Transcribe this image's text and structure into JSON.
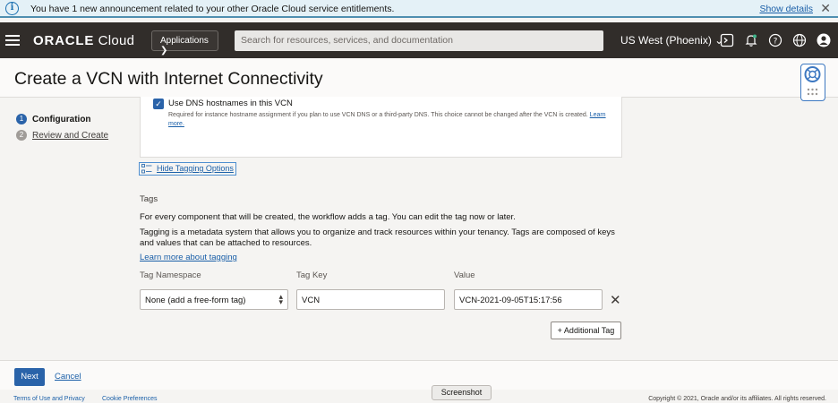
{
  "announcement": {
    "message": "You have 1 new announcement related to your other Oracle Cloud service entitlements.",
    "show_details": "Show details"
  },
  "nav": {
    "brand_bold": "ORACLE",
    "brand_rest": " Cloud",
    "applications": "Applications",
    "search_placeholder": "Search for resources, services, and documentation",
    "region": "US West (Phoenix)"
  },
  "page": {
    "title": "Create a VCN with Internet Connectivity"
  },
  "steps": [
    {
      "num": "1",
      "label": "Configuration"
    },
    {
      "num": "2",
      "label": "Review and Create"
    }
  ],
  "dns": {
    "label": "Use DNS hostnames in this VCN",
    "help": "Required for instance hostname assignment if you plan to use VCN DNS or a third-party DNS. This choice cannot be changed after the VCN is created. ",
    "learn_more": "Learn more."
  },
  "tagging": {
    "toggle": "Hide Tagging Options",
    "section_title": "Tags",
    "desc1": "For every component that will be created, the workflow adds a tag. You can edit the tag now or later.",
    "desc2": "Tagging is a metadata system that allows you to organize and track resources within your tenancy. Tags are composed of keys and values that can be attached to resources.",
    "learn_more": "Learn more about tagging",
    "col_namespace": "Tag Namespace",
    "col_key": "Tag Key",
    "col_value": "Value",
    "namespace_value": "None (add a free-form tag)",
    "key_value": "VCN",
    "value_value": "VCN-2021-09-05T15:17:56",
    "add_tag": "+ Additional Tag"
  },
  "actions": {
    "next": "Next",
    "cancel": "Cancel"
  },
  "footer": {
    "terms": "Terms of Use and Privacy",
    "cookies": "Cookie Preferences",
    "copyright": "Copyright © 2021, Oracle and/or its affiliates. All rights reserved."
  },
  "tooltip": "Screenshot",
  "colors": {
    "accent": "#2a63a9",
    "nav_bg": "#312d2a",
    "link": "#1a5fa8"
  }
}
